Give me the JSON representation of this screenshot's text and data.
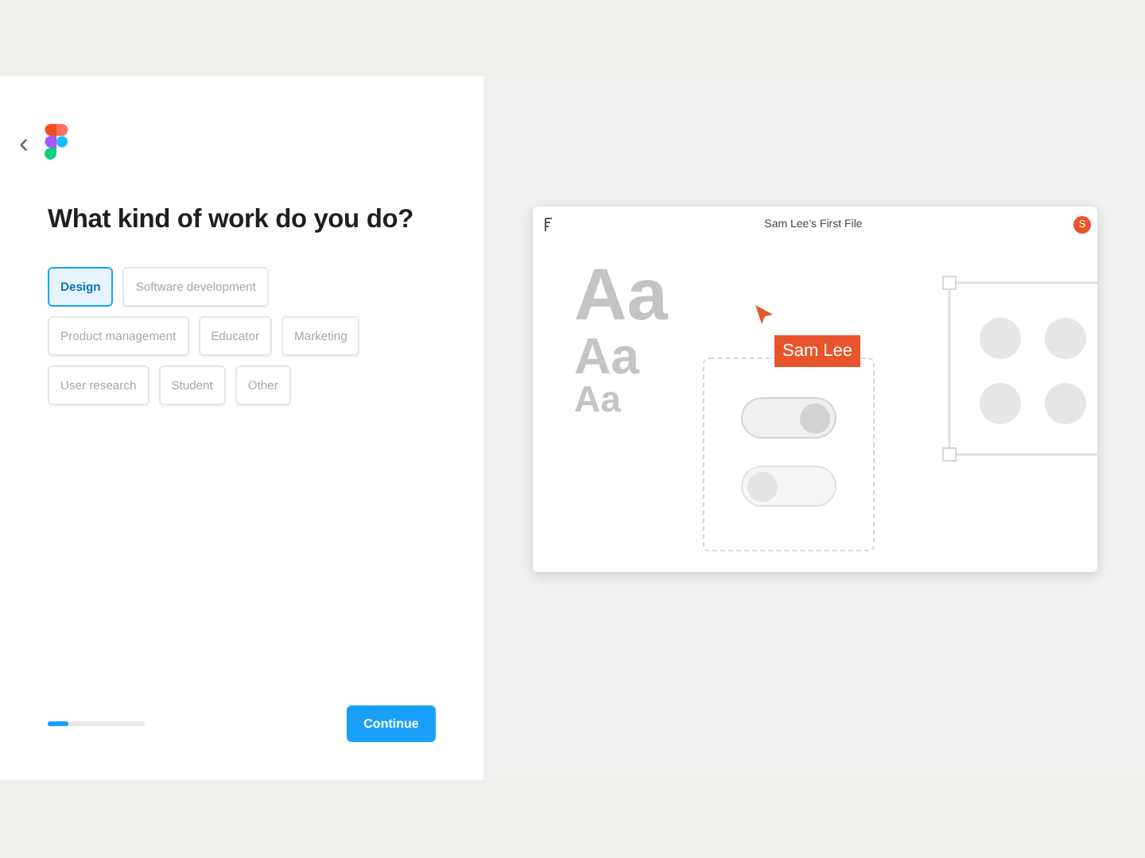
{
  "onboarding": {
    "back": "‹",
    "heading": "What kind of work do you do?",
    "options": [
      {
        "label": "Design",
        "selected": true
      },
      {
        "label": "Software development",
        "selected": false
      },
      {
        "label": "Product management",
        "selected": false
      },
      {
        "label": "Educator",
        "selected": false
      },
      {
        "label": "Marketing",
        "selected": false
      },
      {
        "label": "User research",
        "selected": false
      },
      {
        "label": "Student",
        "selected": false
      },
      {
        "label": "Other",
        "selected": false
      }
    ],
    "progress": {
      "level": 0.21
    },
    "continue_button": "Continue"
  },
  "preview": {
    "title": "Sam Lee's First File",
    "avatar": "S",
    "samples": [
      "Aa",
      "Aa",
      "Aa"
    ],
    "cursor_label": "Sam Lee",
    "toggles": [
      {
        "on": true
      },
      {
        "on": false
      }
    ]
  }
}
